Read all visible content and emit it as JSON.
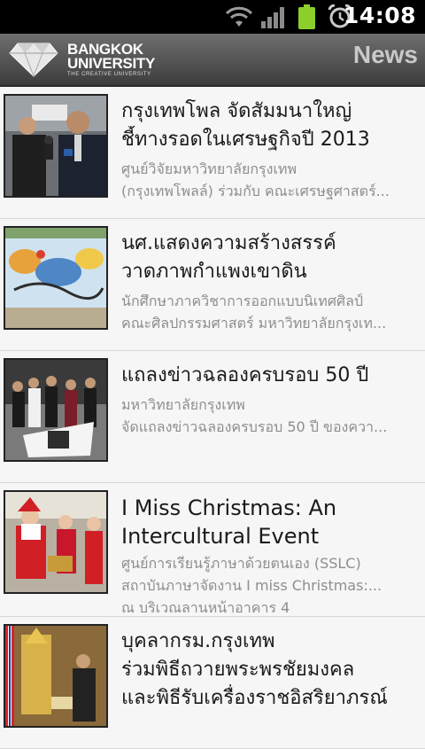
{
  "status_bar": {
    "time": "14:08",
    "icons": [
      "wifi-icon",
      "signal-icon",
      "battery-icon",
      "alarm-icon"
    ]
  },
  "app_bar": {
    "logo_line1": "BANGKOK",
    "logo_line2": "UNIVERSITY",
    "logo_tagline": "THE CREATIVE UNIVERSITY",
    "title": "News"
  },
  "news": [
    {
      "title_lines": [
        "กรุงเทพโพล จัดสัมมนาใหญ่",
        "ชี้ทางรอดในเศรษฐกิจปี 2013"
      ],
      "desc_lines": [
        "ศูนย์วิจัยมหาวิทยาลัยกรุงเทพ",
        "(กรุงเทพโพลล์) ร่วมกับ คณะเศรษฐศาสตร์..."
      ],
      "thumb": "press-conference-photo"
    },
    {
      "title_lines": [
        "นศ.แสดงความสร้างสรรค์",
        "วาดภาพกำแพงเขาดิน"
      ],
      "desc_lines": [
        "นักศึกษาภาควิชาการออกแบบนิเทศศิลป์",
        "คณะศิลปกรรมศาสตร์ มหาวิทยาลัยกรุงเท..."
      ],
      "thumb": "wall-mural-photo"
    },
    {
      "title_lines": [
        "แถลงข่าวฉลองครบรอบ 50 ปี"
      ],
      "desc_lines": [
        "มหาวิทยาลัยกรุงเทพ",
        "จัดแถลงข่าวฉลองครบรอบ 50 ปี ของควา..."
      ],
      "thumb": "anniversary-photo"
    },
    {
      "title_lines": [
        "I Miss Christmas: An",
        "Intercultural Event"
      ],
      "desc_lines": [
        "ศูนย์การเรียนรู้ภาษาด้วยตนเอง (SSLC)",
        "สถาบันภาษาจัดงาน I miss Christmas:...",
        "ณ บริเวณลานหน้าอาคาร 4"
      ],
      "thumb": "christmas-photo"
    },
    {
      "title_lines": [
        "บุคลากรม.กรุงเทพ",
        "ร่วมพิธีถวายพระพรชัยมงคล",
        "และพิธีรับเครื่องราชอิสริยาภรณ์"
      ],
      "desc_lines": [],
      "thumb": "ceremony-photo"
    }
  ]
}
